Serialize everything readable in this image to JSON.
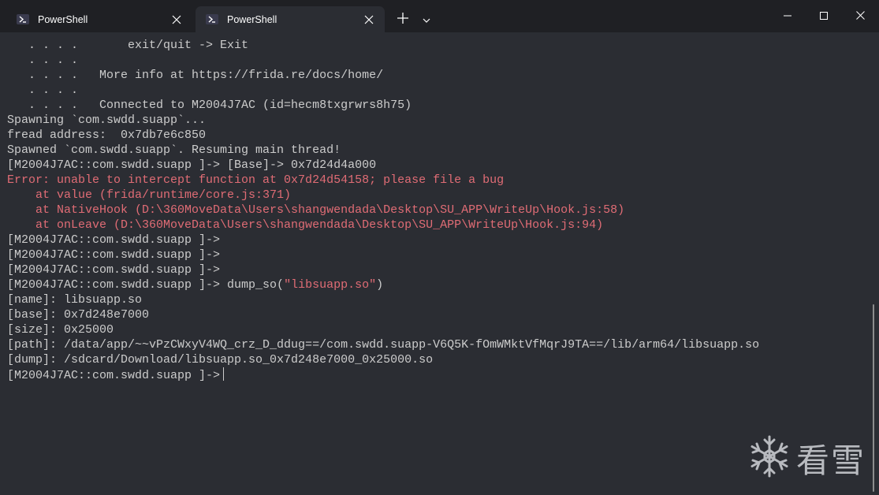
{
  "tabs": [
    {
      "title": "PowerShell",
      "active": false
    },
    {
      "title": "PowerShell",
      "active": true
    }
  ],
  "icons": {
    "tab_icon": "powershell-icon",
    "close": "close-icon",
    "new_tab": "plus-icon",
    "dropdown": "chevron-down-icon",
    "minimize": "minimize-icon",
    "maximize": "maximize-icon",
    "window_close": "close-icon",
    "watermark": "snowflake-icon"
  },
  "colors": {
    "background": "#2b2d33",
    "titlebar": "#1f2024",
    "text": "#cccccc",
    "error": "#e06c75"
  },
  "terminal": {
    "lines": [
      {
        "text": "   . . . .       exit/quit -> Exit"
      },
      {
        "text": "   . . . ."
      },
      {
        "text": "   . . . .   More info at https://frida.re/docs/home/"
      },
      {
        "text": "   . . . ."
      },
      {
        "text": "   . . . .   Connected to M2004J7AC (id=hecm8txgrwrs8h75)"
      },
      {
        "text": "Spawning `com.swdd.suapp`..."
      },
      {
        "text": "fread address:  0x7db7e6c850"
      },
      {
        "text": "Spawned `com.swdd.suapp`. Resuming main thread!"
      },
      {
        "text": "[M2004J7AC::com.swdd.suapp ]-> [Base]-> 0x7d24d4a000"
      },
      {
        "text": "Error: unable to intercept function at 0x7d24d54158; please file a bug",
        "style": "error"
      },
      {
        "text": "    at value (frida/runtime/core.js:371)",
        "style": "error"
      },
      {
        "text": "    at NativeHook (D:\\360MoveData\\Users\\shangwendada\\Desktop\\SU_APP\\WriteUp\\Hook.js:58)",
        "style": "error"
      },
      {
        "text": "    at onLeave (D:\\360MoveData\\Users\\shangwendada\\Desktop\\SU_APP\\WriteUp\\Hook.js:94)",
        "style": "error"
      },
      {
        "text": "[M2004J7AC::com.swdd.suapp ]->"
      },
      {
        "text": "[M2004J7AC::com.swdd.suapp ]->"
      },
      {
        "text": "[M2004J7AC::com.swdd.suapp ]->"
      },
      {
        "text": "[M2004J7AC::com.swdd.suapp ]-> dump_so(",
        "string_arg": "\"libsuapp.so\"",
        "suffix": ")"
      },
      {
        "text": "[name]: libsuapp.so"
      },
      {
        "text": "[base]: 0x7d248e7000"
      },
      {
        "text": "[size]: 0x25000"
      },
      {
        "text": "[path]: /data/app/~~vPzCWxyV4WQ_crz_D_ddug==/com.swdd.suapp-V6Q5K-fOmWMktVfMqrJ9TA==/lib/arm64/libsuapp.so"
      },
      {
        "text": "[dump]: /sdcard/Download/libsuapp.so_0x7d248e7000_0x25000.so"
      },
      {
        "text": "[M2004J7AC::com.swdd.suapp ]->",
        "cursor": true
      }
    ]
  },
  "watermark": {
    "text": "看雪"
  }
}
